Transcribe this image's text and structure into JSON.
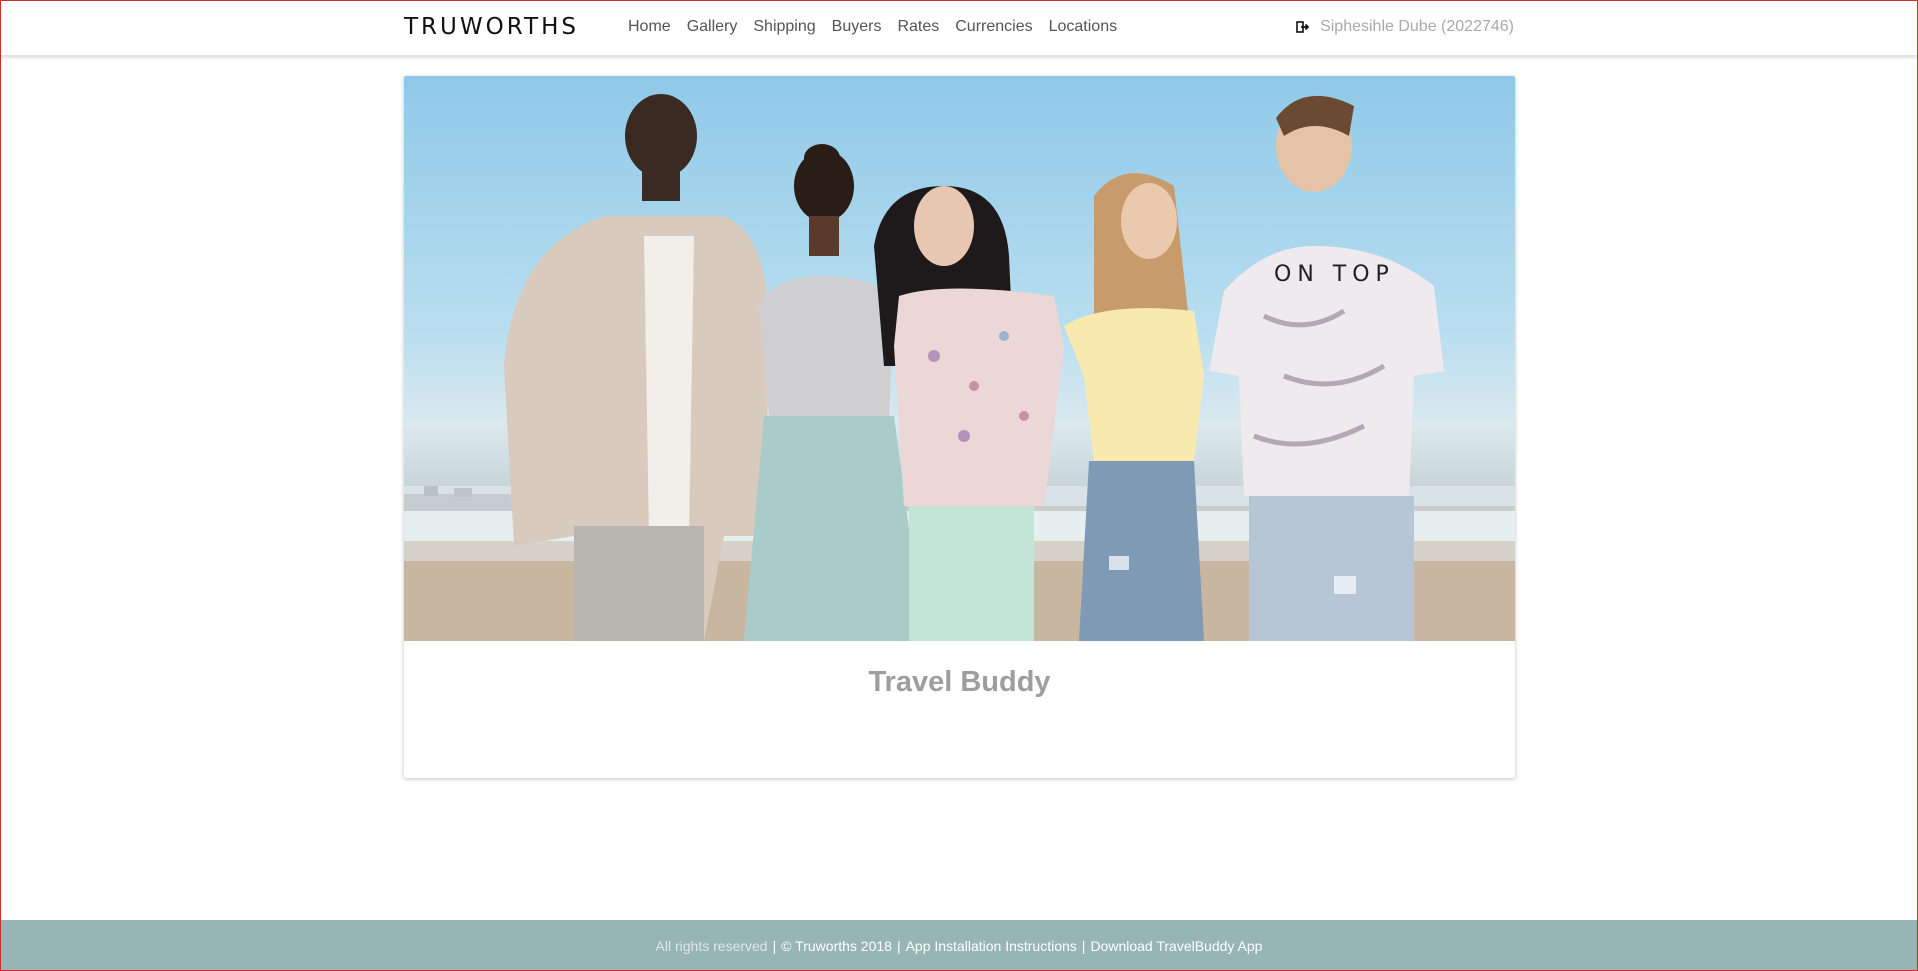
{
  "navbar": {
    "brand": "TRUWORTHS",
    "links": [
      "Home",
      "Gallery",
      "Shipping",
      "Buyers",
      "Rates",
      "Currencies",
      "Locations"
    ],
    "user_label": "Siphesihle Dube (2022746)",
    "user_icon": "logout-icon"
  },
  "hero": {
    "image_alt": "Five models posing on a beach"
  },
  "card": {
    "title": "Travel Buddy"
  },
  "footer": {
    "rights": "All rights reserved",
    "copyright": "© Truworths 2018",
    "install_link": "App Installation Instructions",
    "download_link": "Download TravelBuddy App",
    "bg_color": "#97b5b4"
  },
  "colors": {
    "frame_border": "#c9302c",
    "title_gray": "#9e9e9e"
  }
}
